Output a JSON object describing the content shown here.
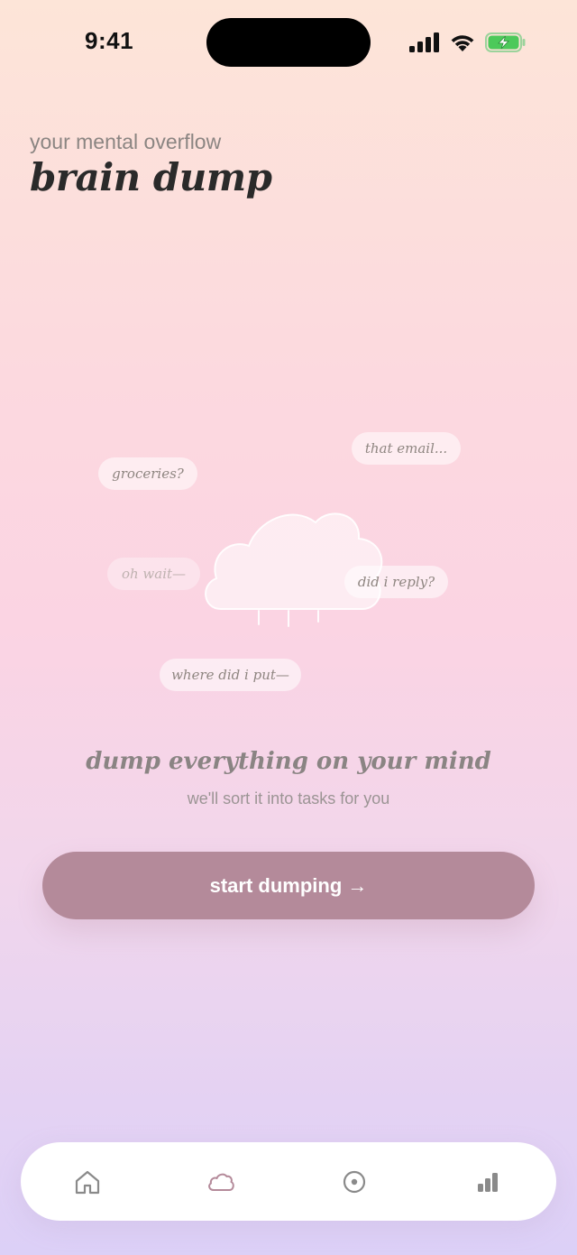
{
  "status_bar": {
    "time": "9:41",
    "icons": [
      "cellular-signal-icon",
      "wifi-icon",
      "battery-charging-icon"
    ]
  },
  "header": {
    "subtitle": "your mental overflow",
    "title": "brain dump"
  },
  "illustration": {
    "thoughts": [
      "that email...",
      "groceries?",
      "oh wait—",
      "did i reply?",
      "where did i put—"
    ],
    "icon": "cloud-icon"
  },
  "prompt": {
    "title": "dump everything on your mind",
    "subtitle": "we'll sort it into tasks for you"
  },
  "cta": {
    "label": "start dumping →"
  },
  "tab_bar": {
    "items": [
      {
        "icon": "home-icon",
        "active": false
      },
      {
        "icon": "cloud-icon",
        "active": true
      },
      {
        "icon": "focus-icon",
        "active": false
      },
      {
        "icon": "stats-icon",
        "active": false
      }
    ]
  },
  "colors": {
    "accent": "#b48a9a",
    "title_text": "#2a2a2a",
    "muted_text": "#8b8582",
    "tab_icon": "#8a8a8a",
    "tab_icon_active": "#b48a9a",
    "background_top": "#fde5d8",
    "background_bottom": "#dcd0f7"
  }
}
